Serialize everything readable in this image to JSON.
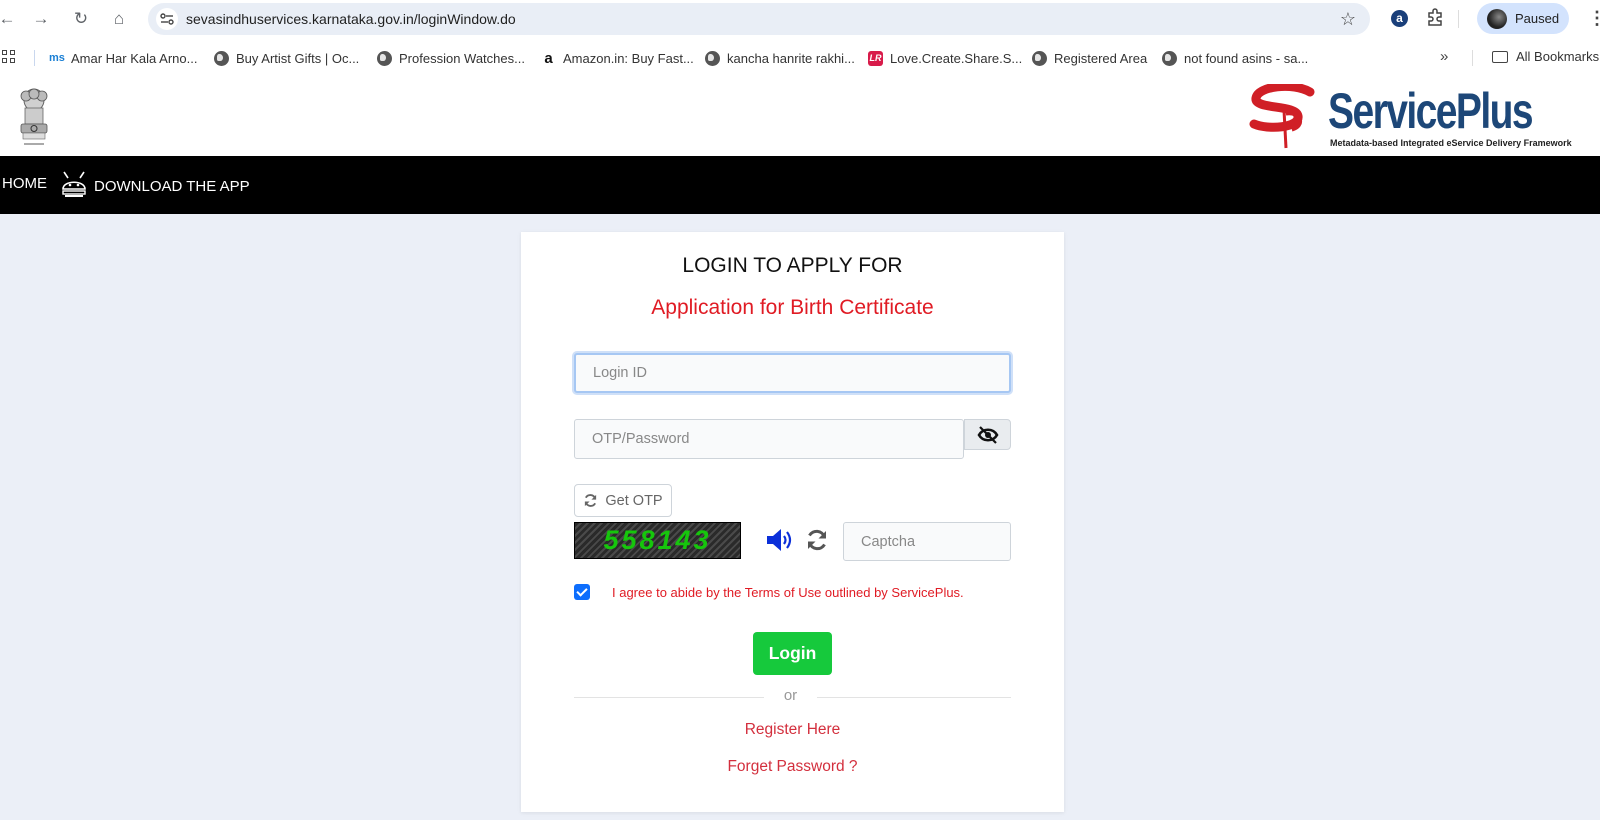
{
  "browser": {
    "url": "sevasindhuservices.karnataka.gov.in/loginWindow.do",
    "profile_label": "Paused",
    "extension_letter": "a",
    "bookmarks": [
      {
        "label": "Amar Har Kala Arno...",
        "icon": "ms-icon"
      },
      {
        "label": "Buy Artist Gifts | Oc...",
        "icon": "globe-icon"
      },
      {
        "label": "Profession Watches...",
        "icon": "globe-icon"
      },
      {
        "label": "Amazon.in: Buy Fast...",
        "icon": "amazon-icon"
      },
      {
        "label": "kancha hanrite rakhi...",
        "icon": "globe-icon"
      },
      {
        "label": "Love.Create.Share.S...",
        "icon": "lr-icon"
      },
      {
        "label": "Registered Area",
        "icon": "globe-icon"
      },
      {
        "label": "not found asins - sa...",
        "icon": "globe-icon"
      }
    ],
    "icon_glyphs": {
      "ms": "ms",
      "amazon": "a",
      "lr": "LR"
    },
    "more_bookmarks": "»",
    "all_bookmarks": "All Bookmarks"
  },
  "header": {
    "logo_title": "ServicePlus",
    "logo_tagline": "Metadata-based Integrated eService Delivery Framework"
  },
  "nav": {
    "home": "HOME",
    "download_app": "DOWNLOAD THE APP"
  },
  "login": {
    "title": "LOGIN TO APPLY FOR",
    "service_name": "Application for Birth Certificate",
    "login_id_placeholder": "Login ID",
    "login_id_value": "",
    "password_placeholder": "OTP/Password",
    "password_value": "",
    "get_otp_label": "Get OTP",
    "captcha_code": "558143",
    "captcha_placeholder": "Captcha",
    "captcha_value": "",
    "terms_checked": true,
    "terms_text": "I agree to abide by the Terms of Use outlined by ServicePlus.",
    "login_button": "Login",
    "or_text": "or",
    "register_link": "Register Here",
    "forgot_link": "Forget Password ?"
  },
  "colors": {
    "accent_red": "#e01b24",
    "login_green": "#16c93c",
    "brand_blue": "#1d4778",
    "captcha_green": "#16c60c"
  }
}
